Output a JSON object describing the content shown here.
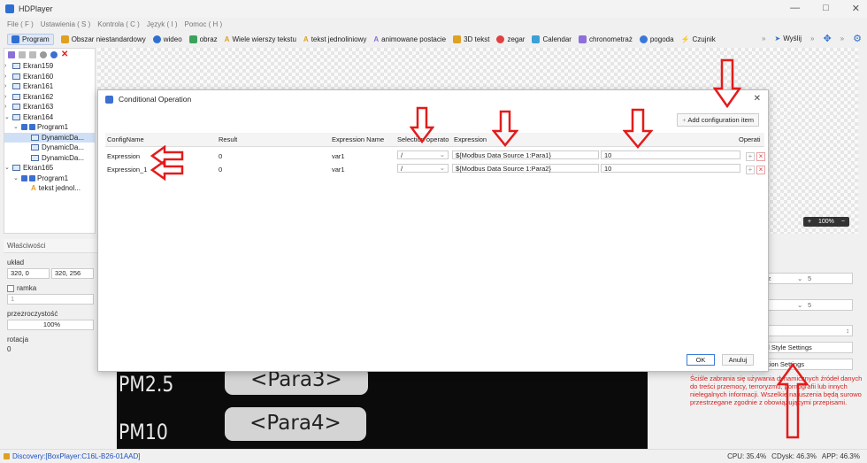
{
  "app": {
    "title": "HDPlayer",
    "window_controls": [
      "—",
      "□",
      "✕"
    ]
  },
  "menu": [
    "File ( F )",
    "Ustawienia ( S )",
    "Kontrola ( C )",
    "Język ( I )",
    "Pomoc ( H )"
  ],
  "toolbar": {
    "items": [
      {
        "label": "Program",
        "icon": "program-icon",
        "color": "#2f6fd1"
      },
      {
        "label": "Obszar niestandardowy",
        "icon": "custom-area-icon",
        "color": "#e0a020"
      },
      {
        "label": "wideo",
        "icon": "video-icon",
        "color": "#2f6fd1"
      },
      {
        "label": "obraz",
        "icon": "image-icon",
        "color": "#3aa35a"
      },
      {
        "label": "Wiele wierszy tekstu",
        "icon": "multiline-text-icon",
        "color": "#e0a020"
      },
      {
        "label": "tekst jednoliniowy",
        "icon": "single-line-text-icon",
        "color": "#e0a020"
      },
      {
        "label": "animowane postacie",
        "icon": "animated-text-icon",
        "color": "#8c6fd8"
      },
      {
        "label": "3D tekst",
        "icon": "3d-text-icon",
        "color": "#e0a020"
      },
      {
        "label": "zegar",
        "icon": "clock-icon",
        "color": "#e04040"
      },
      {
        "label": "Calendar",
        "icon": "calendar-icon",
        "color": "#3aa0d8"
      },
      {
        "label": "chronometraż",
        "icon": "stopwatch-icon",
        "color": "#8c6fd8"
      },
      {
        "label": "pogoda",
        "icon": "weather-icon",
        "color": "#3a78d8"
      },
      {
        "label": "Czujnik",
        "icon": "sensor-icon",
        "color": "#e0a020"
      }
    ],
    "send_label": "Wyślij"
  },
  "tree": {
    "screens": [
      {
        "label": "Ekran159"
      },
      {
        "label": "Ekran160"
      },
      {
        "label": "Ekran161"
      },
      {
        "label": "Ekran162"
      },
      {
        "label": "Ekran163"
      },
      {
        "label": "Ekran164"
      }
    ],
    "ekran164_children": [
      {
        "label": "Program1",
        "level": 1
      },
      {
        "label": "DynamicDa...",
        "level": 2,
        "selected": true
      },
      {
        "label": "DynamicDa...",
        "level": 2
      },
      {
        "label": "DynamicDa...",
        "level": 2
      }
    ],
    "ekran165": {
      "label": "Ekran165"
    },
    "ekran165_children": [
      {
        "label": "Program1",
        "level": 1
      },
      {
        "label": "tekst jednol...",
        "level": 2
      }
    ]
  },
  "zoom": {
    "label": "100%",
    "plus": "+",
    "minus": "−"
  },
  "properties": {
    "header": "Właściwości",
    "layout_label": "układ",
    "pos": "320, 0",
    "size": "320, 256",
    "border_label": "ramka",
    "border_value": "1",
    "opacity_label": "przezroczystość",
    "opacity_value": "100%",
    "rotation_label": "rotacja",
    "rotation_value": "0"
  },
  "preview": {
    "rows": [
      {
        "label": "PM2.5",
        "value": "<Para3>"
      },
      {
        "label": "PM10",
        "value": "<Para4>"
      }
    ]
  },
  "right_panel": {
    "sel1_label": "cz",
    "sel1_value": "5",
    "sel2_value": "5",
    "btn1": "al Style Settings",
    "btn2": "ction Settings"
  },
  "warning": "Ściśle zabrania się używania dynamicznych źródeł danych do treści przemocy, terroryzmu, pornografii lub innych nielegalnych informacji. Wszelkie naruszenia będą surowo przestrzegane zgodnie z obowiązującymi przepisami.",
  "status": {
    "discovery": "Discovery:[BoxPlayer:C16L-B26-01AAD]",
    "cpu": "CPU: 35.4%",
    "cdisk": "CDysk: 46.3%",
    "app": "APP: 46.3%"
  },
  "dialog": {
    "title": "Conditional Operation",
    "add_button": "Add configuration item",
    "columns": [
      "ConfigName",
      "Result",
      "Expression Name",
      "Selection operato",
      "Expression",
      "Operati"
    ],
    "rows": [
      {
        "config": "Expression",
        "result": "0",
        "expr_name": "var1",
        "operator": "/",
        "expression": "${Modbus Data Source 1:Para1}",
        "value": "10"
      },
      {
        "config": "Expression_1",
        "result": "0",
        "expr_name": "var1",
        "operator": "/",
        "expression": "${Modbus Data Source 1:Para2}",
        "value": "10"
      }
    ],
    "ok": "OK",
    "cancel": "Anuluj"
  },
  "annotation_color": "#e31b1b"
}
